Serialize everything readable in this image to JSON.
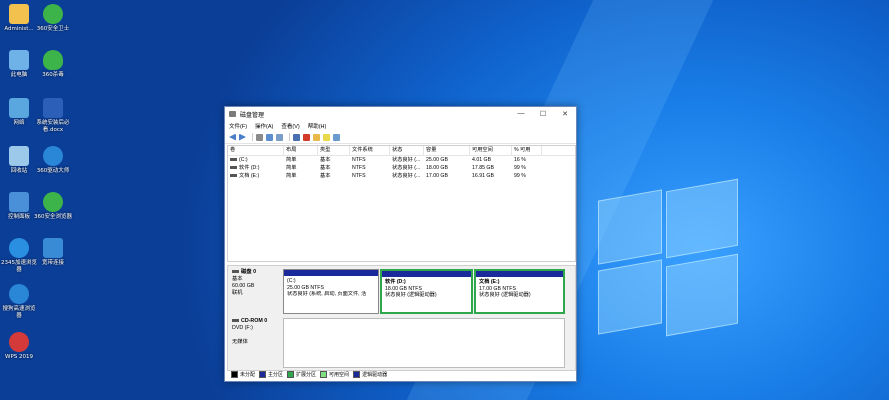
{
  "desktop_icons": [
    {
      "label": "Administ...",
      "icon": "folder-user-icon",
      "color": "#f2c14e"
    },
    {
      "label": "360安全卫士",
      "icon": "360-security-icon",
      "color": "#3cb44a"
    },
    {
      "label": "此电脑",
      "icon": "computer-icon",
      "color": "#6fb2e8"
    },
    {
      "label": "360杀毒",
      "icon": "360-antivirus-icon",
      "color": "#3cb44a"
    },
    {
      "label": "网络",
      "icon": "network-icon",
      "color": "#5aa7e0"
    },
    {
      "label": "系统安装后必看.docx",
      "icon": "word-doc-icon",
      "color": "#2b5fb8"
    },
    {
      "label": "回收站",
      "icon": "recycle-bin-icon",
      "color": "#9cc8ea"
    },
    {
      "label": "360驱动大师",
      "icon": "360-driver-icon",
      "color": "#2a86d6"
    },
    {
      "label": "控制面板",
      "icon": "control-panel-icon",
      "color": "#4a90d9"
    },
    {
      "label": "360安全浏览器",
      "icon": "360-browser-icon",
      "color": "#3cb44a"
    },
    {
      "label": "2345加速浏览器",
      "icon": "2345-browser-icon",
      "color": "#2a8fe0"
    },
    {
      "label": "宽带连接",
      "icon": "broadband-icon",
      "color": "#3a8bd6"
    },
    {
      "label": "搜狗高速浏览器",
      "icon": "sogou-browser-icon",
      "color": "#2a86d6"
    },
    {
      "label": "WPS 2019",
      "icon": "wps-icon",
      "color": "#d43a3a"
    }
  ],
  "window": {
    "title": "磁盘管理",
    "controls": {
      "minimize": "—",
      "maximize": "☐",
      "close": "✕"
    },
    "menu": [
      "文件(F)",
      "操作(A)",
      "查看(V)",
      "帮助(H)"
    ],
    "columns": [
      "卷",
      "布局",
      "类型",
      "文件系统",
      "状态",
      "容量",
      "可用空间",
      "% 可用"
    ],
    "volumes": [
      {
        "name": "(C:)",
        "layout": "简单",
        "type": "基本",
        "fs": "NTFS",
        "status": "状态良好 (...",
        "capacity": "25.00 GB",
        "free": "4.01 GB",
        "pct": "16 %"
      },
      {
        "name": "软件 (D:)",
        "layout": "简单",
        "type": "基本",
        "fs": "NTFS",
        "status": "状态良好 (...",
        "capacity": "18.00 GB",
        "free": "17.85 GB",
        "pct": "99 %"
      },
      {
        "name": "文档 (E:)",
        "layout": "简单",
        "type": "基本",
        "fs": "NTFS",
        "status": "状态良好 (...",
        "capacity": "17.00 GB",
        "free": "16.91 GB",
        "pct": "99 %"
      }
    ],
    "disk0": {
      "name": "磁盘 0",
      "type": "基本",
      "size": "60.00 GB",
      "status": "联机",
      "partitions": [
        {
          "name": "(C:)",
          "size": "25.00 GB NTFS",
          "status": "状态良好 (系统, 启动, 页面文件, 活"
        },
        {
          "name": "软件  (D:)",
          "size": "18.00 GB NTFS",
          "status": "状态良好 (逻辑驱动器)"
        },
        {
          "name": "文档  (E:)",
          "size": "17.00 GB NTFS",
          "status": "状态良好 (逻辑驱动器)"
        }
      ]
    },
    "cdrom0": {
      "name": "CD-ROM 0",
      "type": "DVD (F:)",
      "status": "无媒体"
    },
    "legend": [
      {
        "label": "未分配",
        "color": "#000000"
      },
      {
        "label": "主分区",
        "color": "#1a2a9a"
      },
      {
        "label": "扩展分区",
        "color": "#2ea84a"
      },
      {
        "label": "可用空间",
        "color": "#7fe07f"
      },
      {
        "label": "逻辑驱动器",
        "color": "#1a2a9a"
      }
    ]
  }
}
